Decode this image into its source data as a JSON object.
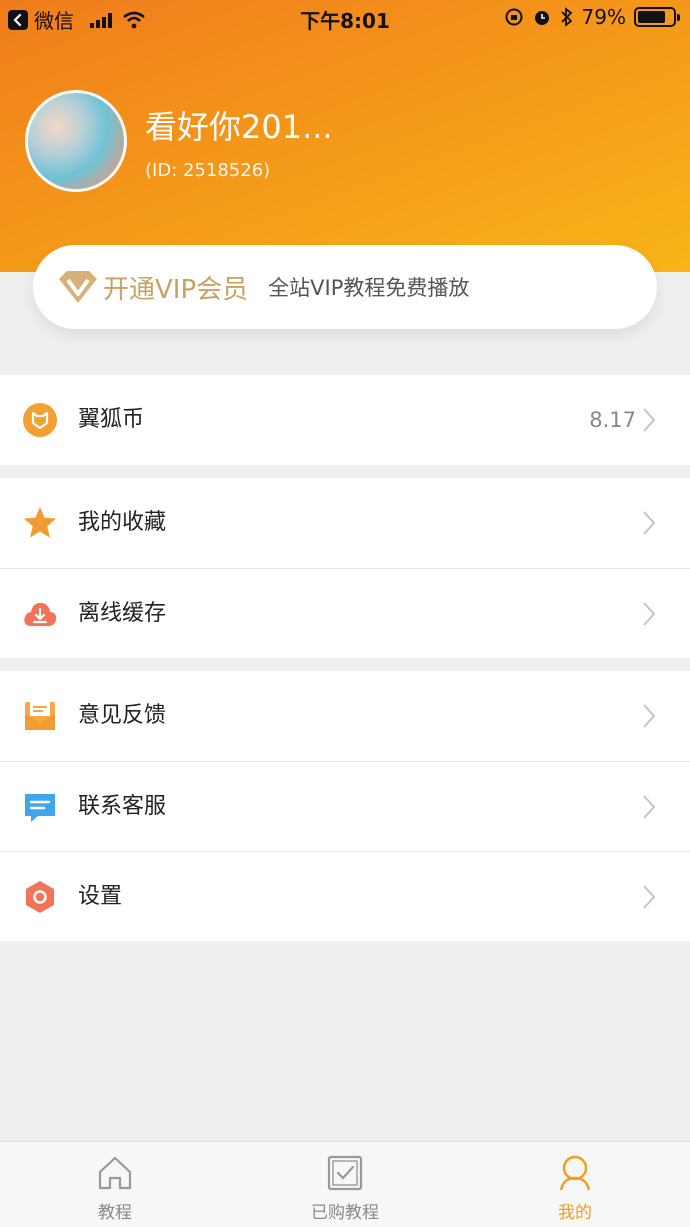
{
  "status_bar": {
    "back_app": "微信",
    "time": "下午8:01",
    "battery": "79%",
    "battery_level": 0.79
  },
  "profile": {
    "name": "看好你201...",
    "id_text": "(ID: 2518526)"
  },
  "vip": {
    "title": "开通VIP会员",
    "desc": "全站VIP教程免费播放",
    "color": "#c8a163"
  },
  "menu": {
    "coins": {
      "label": "翼狐币",
      "value": "8.17",
      "icon": "fox-coin-icon"
    },
    "favorites": {
      "label": "我的收藏",
      "icon": "star-icon"
    },
    "offline": {
      "label": "离线缓存",
      "icon": "download-cloud-icon"
    },
    "feedback": {
      "label": "意见反馈",
      "icon": "mail-icon"
    },
    "support": {
      "label": "联系客服",
      "icon": "chat-bubble-icon"
    },
    "settings": {
      "label": "设置",
      "icon": "hexagon-settings-icon"
    }
  },
  "tabs": [
    {
      "label": "教程",
      "icon": "home-icon"
    },
    {
      "label": "已购教程",
      "icon": "purchased-check-icon"
    },
    {
      "label": "我的",
      "icon": "user-icon",
      "active": true
    }
  ],
  "colors": {
    "accent": "#f39c1d",
    "header_start": "#f07c1c",
    "header_end": "#f8b518"
  }
}
